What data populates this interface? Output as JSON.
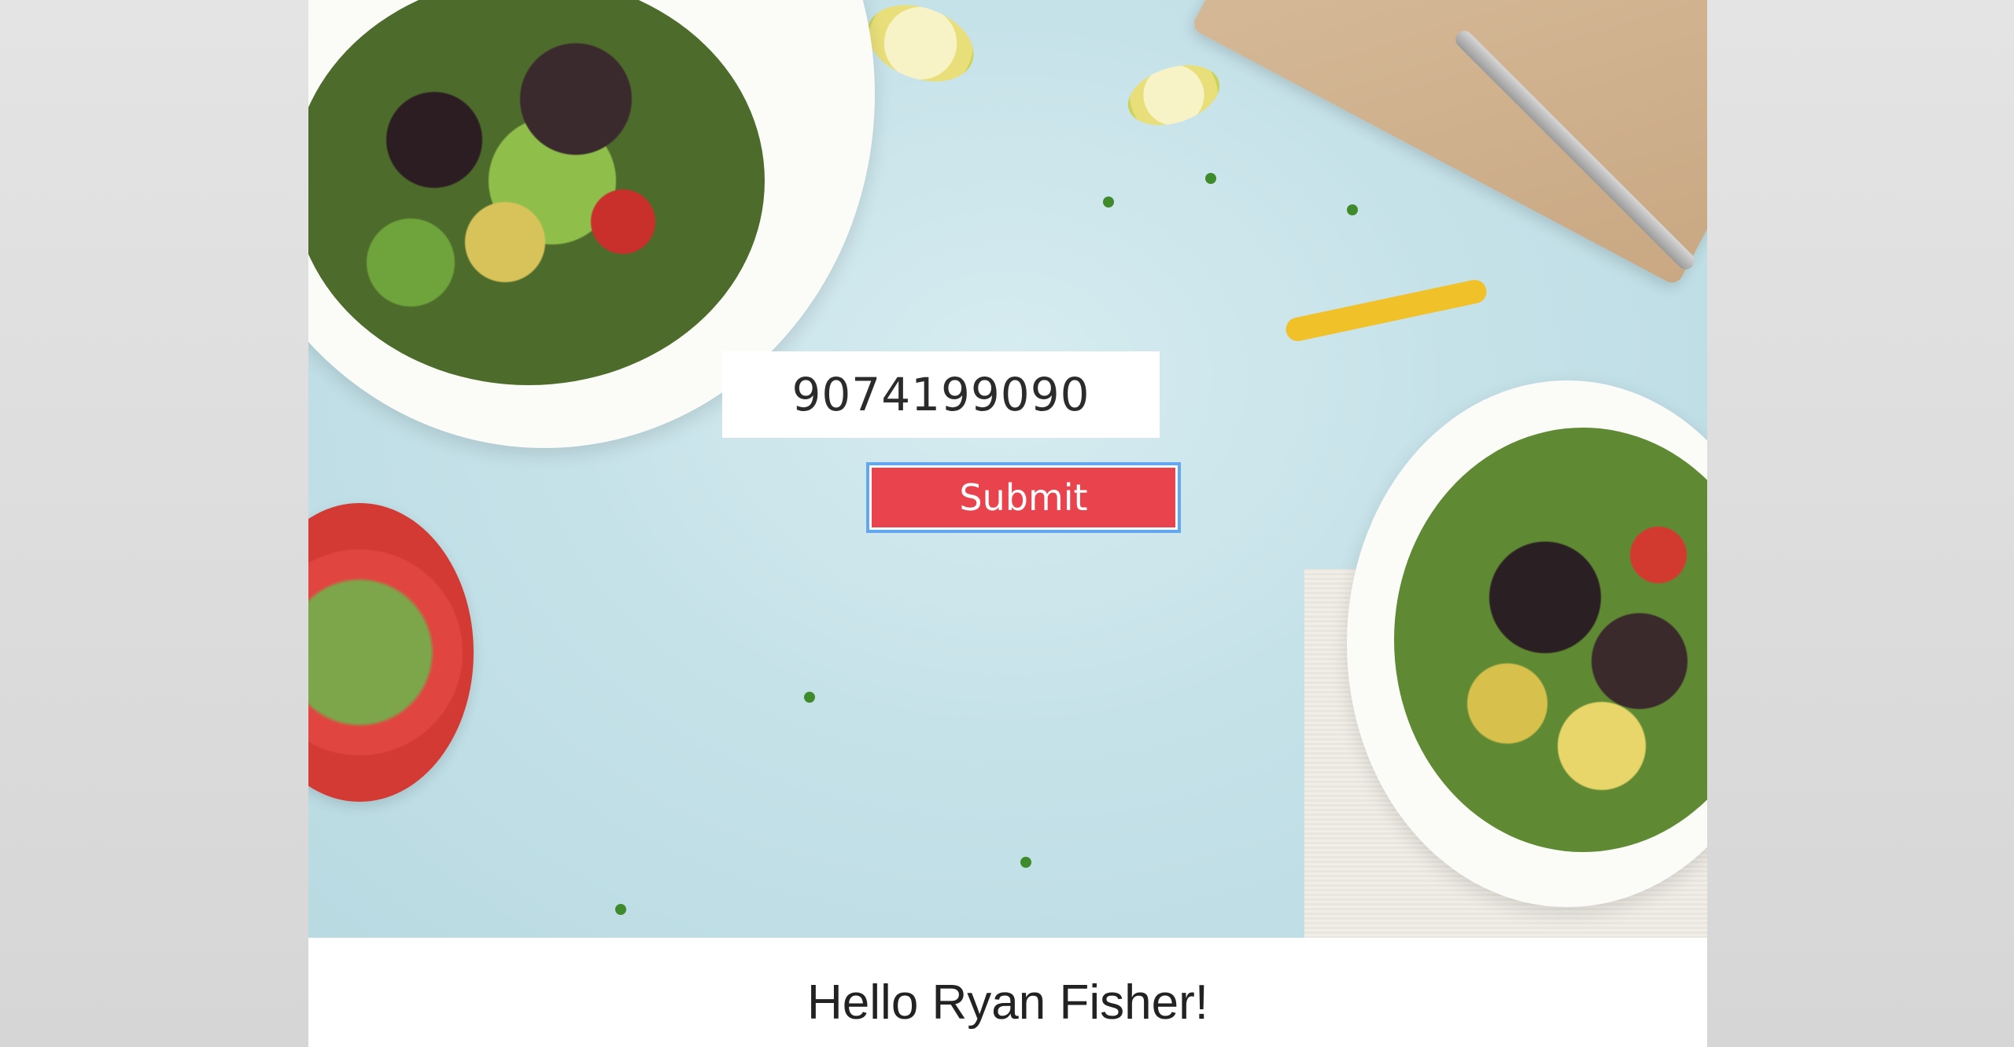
{
  "form": {
    "phone_value": "9074199090",
    "submit_label": "Submit"
  },
  "greeting": {
    "text": "Hello Ryan Fisher!"
  },
  "colors": {
    "submit_bg": "#e9434d",
    "focus_ring": "#63a7f0",
    "hero_bg": "#c6e2e9"
  }
}
